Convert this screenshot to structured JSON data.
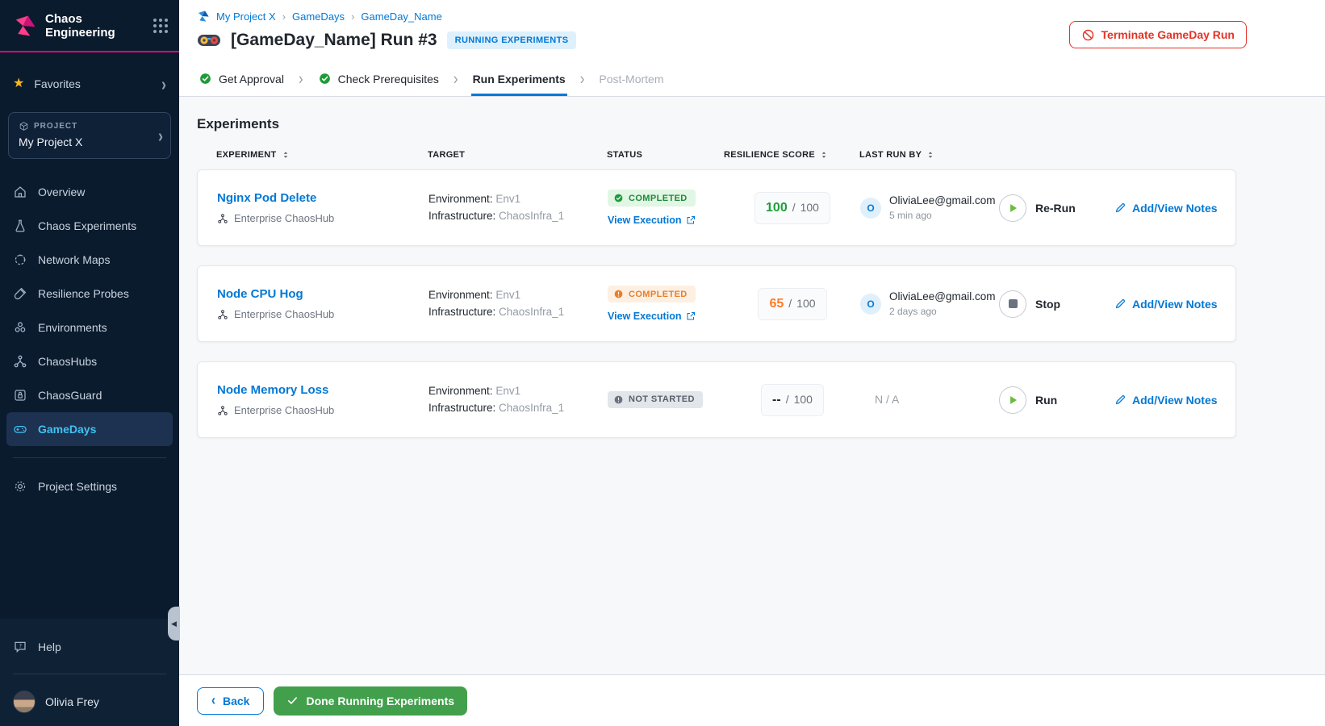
{
  "icons": {
    "chevron_right": "›",
    "chevron_left": "‹",
    "back_chevron": "‹",
    "star": "★",
    "collapse_arrow": "◀"
  },
  "colors": {
    "accent": "#0278d5",
    "magenta": "#e5007e",
    "success": "#1d8a38",
    "warning": "#e8710a",
    "danger": "#e43326",
    "done_button": "#42a04c",
    "play_green": "#6abc3c",
    "selected_nav": "#41c1f2"
  },
  "sidebar": {
    "logo_line1": "Chaos",
    "logo_line2": "Engineering",
    "favorites_label": "Favorites",
    "project_label": "PROJECT",
    "project_name": "My Project X",
    "nav_items": [
      {
        "label": "Overview"
      },
      {
        "label": "Chaos Experiments"
      },
      {
        "label": "Network Maps"
      },
      {
        "label": "Resilience Probes"
      },
      {
        "label": "Environments"
      },
      {
        "label": "ChaosHubs"
      },
      {
        "label": "ChaosGuard"
      },
      {
        "label": "GameDays",
        "active": true
      }
    ],
    "project_settings_label": "Project Settings",
    "help_label": "Help",
    "user_name": "Olivia Frey"
  },
  "header": {
    "breadcrumb": [
      {
        "label": "My Project X"
      },
      {
        "label": "GameDays"
      },
      {
        "label": "GameDay_Name"
      }
    ],
    "title": "[GameDay_Name] Run #3",
    "status_badge": "RUNNING EXPERIMENTS",
    "terminate_label": "Terminate GameDay Run"
  },
  "stepper": {
    "steps": [
      {
        "label": "Get Approval",
        "state": "done"
      },
      {
        "label": "Check Prerequisites",
        "state": "done"
      },
      {
        "label": "Run Experiments",
        "state": "active"
      },
      {
        "label": "Post-Mortem",
        "state": "upcoming"
      }
    ]
  },
  "main": {
    "heading": "Experiments",
    "table": {
      "columns": [
        {
          "label": "EXPERIMENT",
          "sortable": true
        },
        {
          "label": "TARGET",
          "sortable": false
        },
        {
          "label": "STATUS",
          "sortable": false
        },
        {
          "label": "RESILIENCE SCORE",
          "sortable": true
        },
        {
          "label": "LAST RUN BY",
          "sortable": true
        }
      ],
      "env_label": "Environment:",
      "infra_label": "Infrastructure:",
      "slash": "/",
      "rows": [
        {
          "name": "Nginx Pod Delete",
          "hub": "Enterprise ChaosHub",
          "environment": "Env1",
          "infrastructure": "ChaosInfra_1",
          "status": "COMPLETED",
          "status_kind": "success",
          "view_execution": "View Execution",
          "score": "100",
          "score_max": "100",
          "last_run_by": "OliviaLee@gmail.com",
          "last_run_time": "5 min ago",
          "avatar_initial": "O",
          "action": "Re-Run",
          "notes": "Add/View Notes"
        },
        {
          "name": "Node CPU Hog",
          "hub": "Enterprise ChaosHub",
          "environment": "Env1",
          "infrastructure": "ChaosInfra_1",
          "status": "COMPLETED",
          "status_kind": "warning",
          "view_execution": "View Execution",
          "score": "65",
          "score_max": "100",
          "last_run_by": "OliviaLee@gmail.com",
          "last_run_time": "2 days ago",
          "avatar_initial": "O",
          "action": "Stop",
          "notes": "Add/View Notes"
        },
        {
          "name": "Node Memory Loss",
          "hub": "Enterprise ChaosHub",
          "environment": "Env1",
          "infrastructure": "ChaosInfra_1",
          "status": "NOT STARTED",
          "status_kind": "neutral",
          "score": "--",
          "score_max": "100",
          "last_run_na": "N / A",
          "action": "Run",
          "notes": "Add/View Notes"
        }
      ]
    }
  },
  "footer": {
    "back_label": "Back",
    "done_label": "Done Running Experiments"
  }
}
